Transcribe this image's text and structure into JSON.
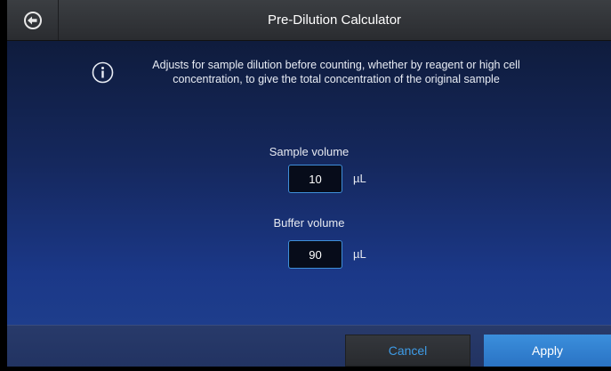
{
  "header": {
    "title": "Pre-Dilution Calculator",
    "back_icon": "back-arrow-icon"
  },
  "info": {
    "icon": "info-icon",
    "text": "Adjusts for sample dilution before counting, whether by reagent or high cell concentration, to give the total concentration of the original sample"
  },
  "sample": {
    "label": "Sample volume",
    "value": "10",
    "unit": "µL"
  },
  "buffer": {
    "label": "Buffer volume",
    "value": "90",
    "unit": "µL"
  },
  "footer": {
    "cancel_label": "Cancel",
    "apply_label": "Apply"
  },
  "colors": {
    "accent": "#3e9be6",
    "apply_bg": "#2f80d1",
    "field_border": "#3f8fd9"
  }
}
